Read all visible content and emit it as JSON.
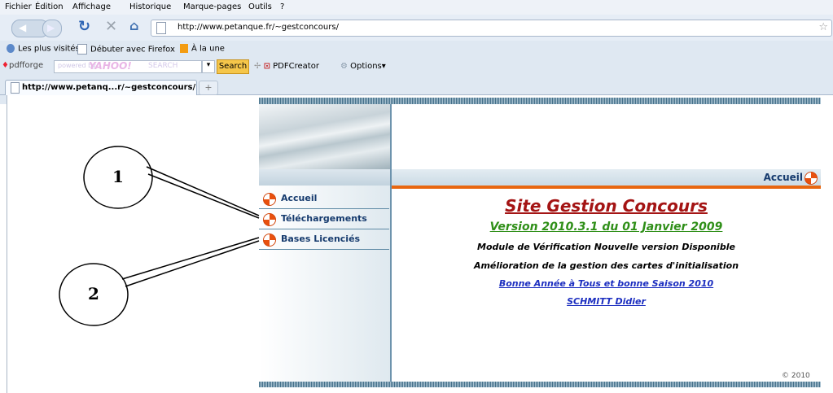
{
  "menubar": {
    "items": [
      "Fichier",
      "Édition",
      "Affichage",
      "Historique",
      "Marque-pages",
      "Outils",
      "?"
    ]
  },
  "navbar": {
    "url": "http://www.petanque.fr/~gestconcours/"
  },
  "bookmarks": {
    "items": [
      "Les plus visités",
      "Débuter avec Firefox",
      "À la une"
    ]
  },
  "toolbar": {
    "pdfforge": "pdfforge",
    "search_placeholder_left": "powered by",
    "search_logo": "YAHOO!",
    "search_placeholder_right": "SEARCH",
    "search_button": "Search",
    "pdfcreator": "PDFCreator",
    "options": "Options"
  },
  "tabs": {
    "active": "http://www.petanq...r/~gestconcours/",
    "newtab": "+"
  },
  "site": {
    "nav": [
      "Accueil",
      "Téléchargements",
      "Bases Licenciés"
    ],
    "header_label": "Accueil",
    "title": "Site Gestion Concours",
    "version": "Version 2010.3.1 du 01 Janvier 2009",
    "module": "Module de Vérification Nouvelle version Disponible",
    "amelioration": "Amélioration de la gestion des cartes d'initialisation",
    "bonne_annee": "Bonne Année à Tous et bonne Saison 2010",
    "author": "SCHMITT Didier",
    "copyright": "© 2010"
  },
  "annotations": {
    "label1": "1",
    "label2": "2"
  },
  "colors": {
    "title": "#a41414",
    "version": "#2f8f18",
    "link": "#1d2fc0",
    "nav_text": "#163b6e",
    "accent": "#e8660f"
  }
}
